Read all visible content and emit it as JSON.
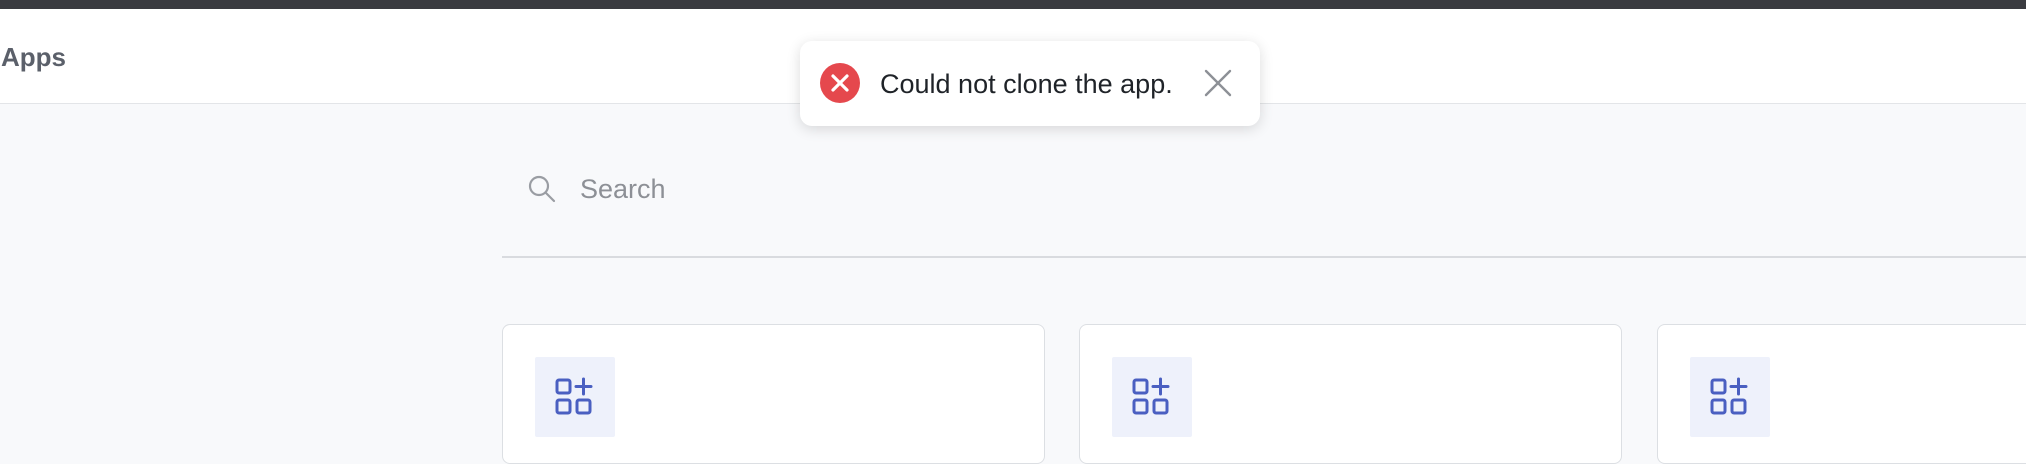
{
  "header": {
    "title": "Apps"
  },
  "toast": {
    "type": "error",
    "message": "Could not clone the app.",
    "icon": "error-x-icon",
    "close_icon": "close-icon",
    "color": "#e5484d"
  },
  "search": {
    "placeholder": "Search",
    "value": "",
    "icon": "search-icon"
  },
  "apps": [
    {
      "icon": "app-add-icon"
    },
    {
      "icon": "app-add-icon"
    },
    {
      "icon": "app-add-icon"
    }
  ],
  "colors": {
    "accent": "#4a5fc1",
    "icon_bg": "#eef1fb",
    "error": "#e5484d",
    "page_bg": "#f8f9fb"
  }
}
